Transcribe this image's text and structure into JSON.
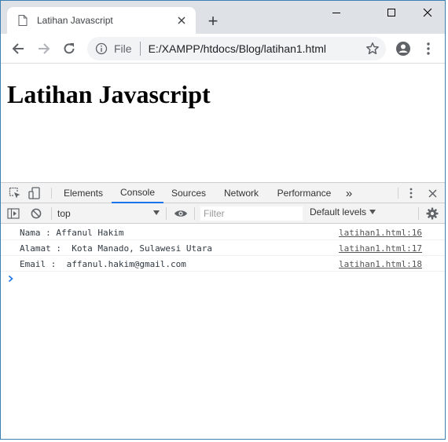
{
  "browser": {
    "tab_title": "Latihan Javascript",
    "new_tab_label": "+",
    "omnibox": {
      "scheme_label": "File",
      "url": "E:/XAMPP/htdocs/Blog/latihan1.html"
    }
  },
  "page": {
    "heading": "Latihan Javascript"
  },
  "devtools": {
    "tabs": [
      {
        "label": "Elements",
        "active": false
      },
      {
        "label": "Console",
        "active": true
      },
      {
        "label": "Sources",
        "active": false
      },
      {
        "label": "Network",
        "active": false
      },
      {
        "label": "Performance",
        "active": false
      }
    ],
    "more_tabs_label": "»",
    "context": "top",
    "filter_placeholder": "Filter",
    "levels_label": "Default levels",
    "logs": [
      {
        "message": "Nama : Affanul Hakim",
        "source": "latihan1.html:16"
      },
      {
        "message": "Alamat :  Kota Manado, Sulawesi Utara",
        "source": "latihan1.html:17"
      },
      {
        "message": "Email :  affanul.hakim@gmail.com",
        "source": "latihan1.html:18"
      }
    ]
  },
  "colors": {
    "accent": "#1a73e8",
    "tabstrip": "#dee1e6",
    "window_border": "#3c7fb1"
  }
}
